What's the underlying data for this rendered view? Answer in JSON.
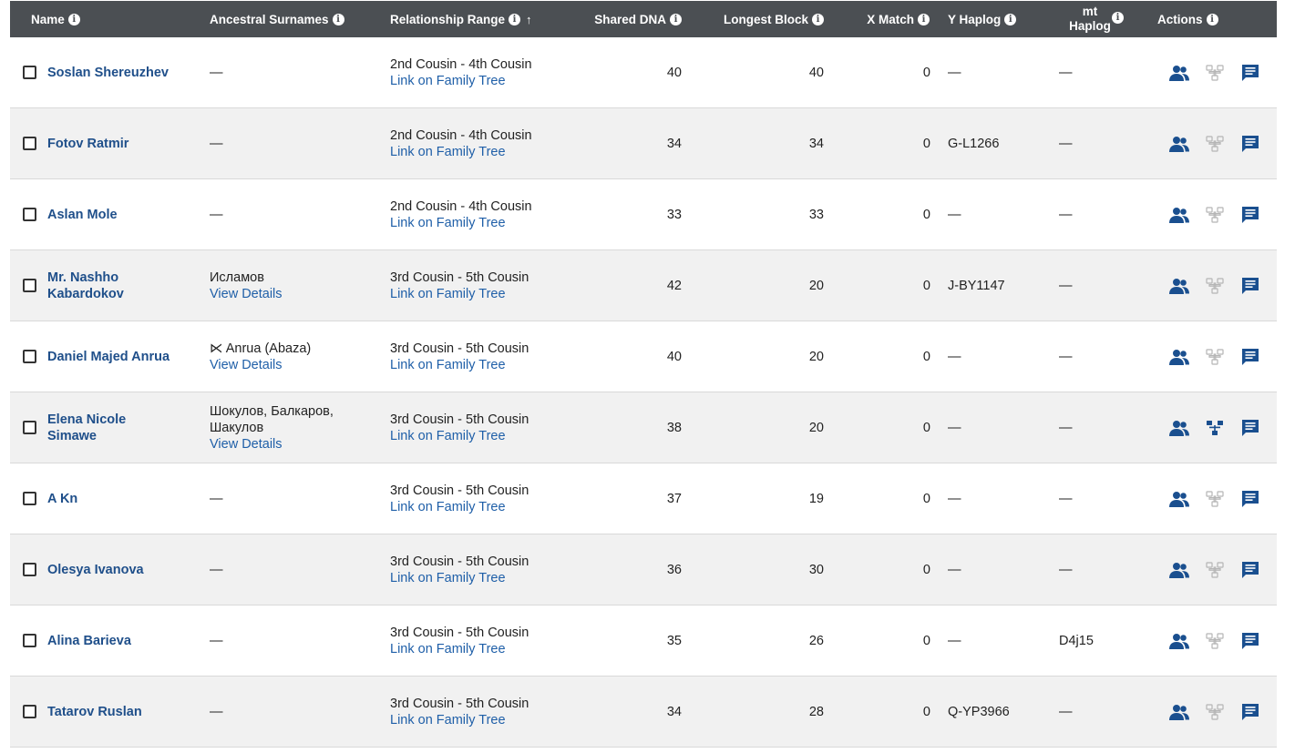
{
  "header": {
    "name": "Name",
    "surnames": "Ancestral Surnames",
    "relationship": "Relationship Range",
    "shared_dna": "Shared DNA",
    "longest_block": "Longest Block",
    "x_match": "X Match",
    "y_haplog": "Y Haplog",
    "mt_haplog_line1": "mt",
    "mt_haplog_line2": "Haplog",
    "actions": "Actions",
    "info_glyph": "i",
    "sort_glyph": "↑"
  },
  "rows": [
    {
      "name_line1": "Soslan Shereuzhev",
      "name_line2": "",
      "surname_line1": "—",
      "surname_line2": "",
      "surname_link": "",
      "relationship": "2nd Cousin - 4th Cousin",
      "tree_link": "Link on Family Tree",
      "shared": "40",
      "longest": "40",
      "x": "0",
      "y": "—",
      "mt": "—",
      "tree_active": false
    },
    {
      "name_line1": "Fotov Ratmir",
      "name_line2": "",
      "surname_line1": "—",
      "surname_line2": "",
      "surname_link": "",
      "relationship": "2nd Cousin - 4th Cousin",
      "tree_link": "Link on Family Tree",
      "shared": "34",
      "longest": "34",
      "x": "0",
      "y": "G-L1266",
      "mt": "—",
      "tree_active": false
    },
    {
      "name_line1": "Aslan Mole",
      "name_line2": "",
      "surname_line1": "—",
      "surname_line2": "",
      "surname_link": "",
      "relationship": "2nd Cousin - 4th Cousin",
      "tree_link": "Link on Family Tree",
      "shared": "33",
      "longest": "33",
      "x": "0",
      "y": "—",
      "mt": "—",
      "tree_active": false
    },
    {
      "name_line1": "Mr. Nashho",
      "name_line2": "Kabardokov",
      "surname_line1": "Исламов",
      "surname_line2": "",
      "surname_link": "View Details",
      "relationship": "3rd Cousin - 5th Cousin",
      "tree_link": "Link on Family Tree",
      "shared": "42",
      "longest": "20",
      "x": "0",
      "y": "J-BY1147",
      "mt": "—",
      "tree_active": false
    },
    {
      "name_line1": "Daniel Majed Anrua",
      "name_line2": "",
      "surname_line1": "⋉ Anrua (Abaza)",
      "surname_line2": "",
      "surname_link": "View Details",
      "relationship": "3rd Cousin - 5th Cousin",
      "tree_link": "Link on Family Tree",
      "shared": "40",
      "longest": "20",
      "x": "0",
      "y": "—",
      "mt": "—",
      "tree_active": false
    },
    {
      "name_line1": "Elena Nicole",
      "name_line2": "Simawe",
      "surname_line1": "Шокулов, Балкаров,",
      "surname_line2": "Шакулов",
      "surname_link": "View Details",
      "relationship": "3rd Cousin - 5th Cousin",
      "tree_link": "Link on Family Tree",
      "shared": "38",
      "longest": "20",
      "x": "0",
      "y": "—",
      "mt": "—",
      "tree_active": true
    },
    {
      "name_line1": "A Kn",
      "name_line2": "",
      "surname_line1": "—",
      "surname_line2": "",
      "surname_link": "",
      "relationship": "3rd Cousin - 5th Cousin",
      "tree_link": "Link on Family Tree",
      "shared": "37",
      "longest": "19",
      "x": "0",
      "y": "—",
      "mt": "—",
      "tree_active": false
    },
    {
      "name_line1": "Olesya Ivanova",
      "name_line2": "",
      "surname_line1": "—",
      "surname_line2": "",
      "surname_link": "",
      "relationship": "3rd Cousin - 5th Cousin",
      "tree_link": "Link on Family Tree",
      "shared": "36",
      "longest": "30",
      "x": "0",
      "y": "—",
      "mt": "—",
      "tree_active": false
    },
    {
      "name_line1": "Alina Barieva",
      "name_line2": "",
      "surname_line1": "—",
      "surname_line2": "",
      "surname_link": "",
      "relationship": "3rd Cousin - 5th Cousin",
      "tree_link": "Link on Family Tree",
      "shared": "35",
      "longest": "26",
      "x": "0",
      "y": "—",
      "mt": "D4j15",
      "tree_active": false
    },
    {
      "name_line1": "Tatarov Ruslan",
      "name_line2": "",
      "surname_line1": "—",
      "surname_line2": "",
      "surname_link": "",
      "relationship": "3rd Cousin - 5th Cousin",
      "tree_link": "Link on Family Tree",
      "shared": "34",
      "longest": "28",
      "x": "0",
      "y": "Q-YP3966",
      "mt": "—",
      "tree_active": false
    }
  ],
  "icons": {
    "people": "people-icon",
    "tree": "family-tree-icon",
    "message": "message-icon"
  },
  "colors": {
    "header_bg": "#4b4f53",
    "link": "#1f5fa8",
    "name": "#1f4f8a",
    "icon_active": "#1a4f8f",
    "icon_inactive": "#b5b5b5",
    "row_alt": "#f1f1f1"
  }
}
